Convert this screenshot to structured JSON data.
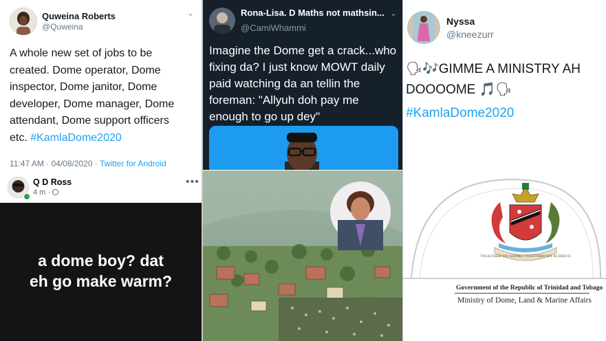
{
  "tweet1": {
    "name": "Quweina Roberts",
    "handle": "@Quweina",
    "text": "A whole new set of jobs to be created. Dome operator, Dome inspector, Dome janitor, Dome developer, Dome manager, Dome attendant, Dome support officers etc. ",
    "hashtag": "#KamlaDome2020",
    "timestamp": "11:47 AM · 04/08/2020 · ",
    "source": "Twitter for Android"
  },
  "tweet2": {
    "name": "Rona-Lisa. D Maths not mathsin...",
    "handle": "@CamiWhammi",
    "text": "Imagine the Dome get a crack...who fixing da? I just know MOWT daily paid watching da an tellin the foreman: \"Allyuh doh pay me enough to go up dey\""
  },
  "tweet3": {
    "name": "Nyssa",
    "handle": "@kneezurr",
    "line1": "🗣🎶GIMME A MINISTRY AH",
    "line2": "DOOOOME 🎵🗣",
    "hashtag": "#KamlaDome2020"
  },
  "fbpost": {
    "name": "Q D Ross",
    "time": "4 m · ",
    "more": "•••",
    "text_line1": "a dome boy? dat",
    "text_line2": "eh go make warm?"
  },
  "seal": {
    "gov_line": "Government of the Republic of Trinidad and Tobago",
    "ministry_line": "Ministry of Dome, Land & Marine Affairs",
    "motto": "TOGETHER WE ASPIRE TOGETHER WE ACHIEVE"
  },
  "icons": {
    "chevron": "chevron-down-icon",
    "globe": "globe-icon",
    "more": "more-options-icon"
  },
  "colors": {
    "twitter_blue": "#1da1f2",
    "dark_bg": "#15202b",
    "post_bg": "#141414"
  }
}
